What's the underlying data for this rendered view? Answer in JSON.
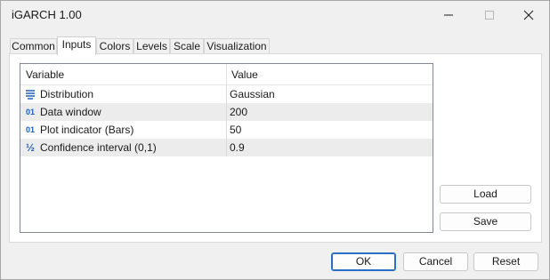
{
  "window": {
    "title": "iGARCH 1.00"
  },
  "tabs": [
    {
      "label": "Common",
      "active": false
    },
    {
      "label": "Inputs",
      "active": true
    },
    {
      "label": "Colors",
      "active": false
    },
    {
      "label": "Levels",
      "active": false
    },
    {
      "label": "Scale",
      "active": false
    },
    {
      "label": "Visualization",
      "active": false
    }
  ],
  "grid": {
    "columns": {
      "variable": "Variable",
      "value": "Value"
    },
    "rows": [
      {
        "icon": "enum-list-icon",
        "variable": "Distribution",
        "value": "Gaussian"
      },
      {
        "icon": "integer-icon",
        "icon_text": "01",
        "variable": "Data window",
        "value": "200"
      },
      {
        "icon": "integer-icon",
        "icon_text": "01",
        "variable": "Plot indicator (Bars)",
        "value": "50"
      },
      {
        "icon": "fraction-icon",
        "icon_text": "½",
        "variable": "Confidence interval (0,1)",
        "value": "0.9"
      }
    ]
  },
  "side_buttons": {
    "load": "Load",
    "save": "Save"
  },
  "footer_buttons": {
    "ok": "OK",
    "cancel": "Cancel",
    "reset": "Reset"
  },
  "colors": {
    "accent": "#2b6fc5",
    "icon": "#1f5fbf",
    "alt_row": "#ececec"
  }
}
